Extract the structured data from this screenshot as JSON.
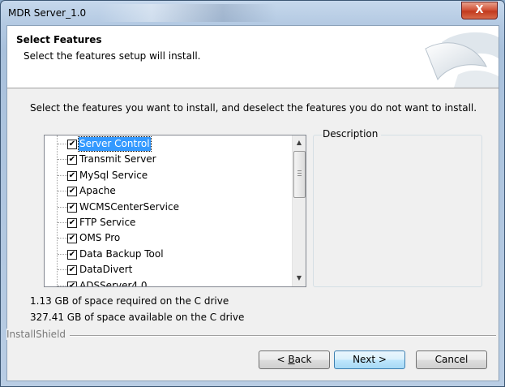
{
  "window": {
    "title": "MDR Server_1.0",
    "close_symbol": "X"
  },
  "header": {
    "title": "Select Features",
    "subtitle": "Select the features setup will install."
  },
  "instruction": "Select the features you want to install, and deselect the features you do not want to install.",
  "features": [
    {
      "label": "Server Control",
      "checked": true,
      "selected": true
    },
    {
      "label": "Transmit Server",
      "checked": true,
      "selected": false
    },
    {
      "label": "MySql Service",
      "checked": true,
      "selected": false
    },
    {
      "label": "Apache",
      "checked": true,
      "selected": false
    },
    {
      "label": "WCMSCenterService",
      "checked": true,
      "selected": false
    },
    {
      "label": "FTP Service",
      "checked": true,
      "selected": false
    },
    {
      "label": "OMS Pro",
      "checked": true,
      "selected": false
    },
    {
      "label": "Data Backup Tool",
      "checked": true,
      "selected": false
    },
    {
      "label": "DataDivert",
      "checked": true,
      "selected": false
    },
    {
      "label": "ADSServer4.0",
      "checked": true,
      "selected": false
    }
  ],
  "description": {
    "label": "Description"
  },
  "space": {
    "required": "1.13 GB of space required on the C drive",
    "available": "327.41 GB of space available on the C drive"
  },
  "brand": "InstallShield",
  "buttons": {
    "back_prefix": "< ",
    "back_mnemonic": "B",
    "back_rest": "ack",
    "next": "Next >",
    "cancel": "Cancel"
  }
}
